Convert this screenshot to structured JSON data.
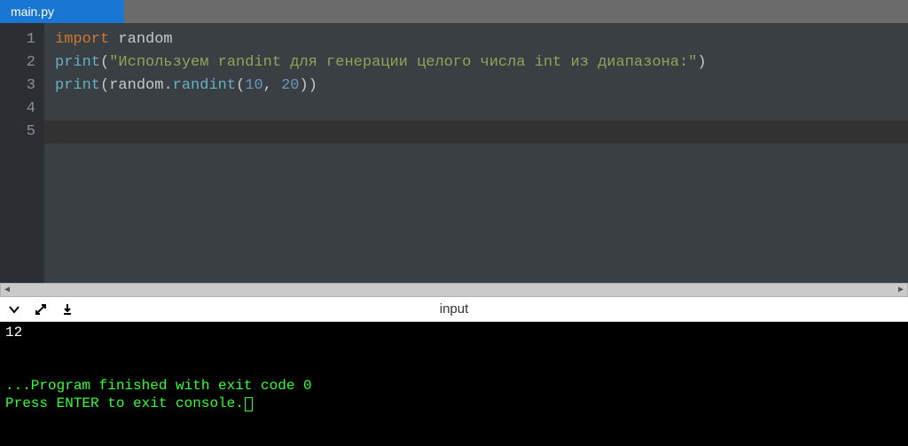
{
  "tab": {
    "filename": "main.py"
  },
  "editor": {
    "line_numbers": [
      "1",
      "2",
      "3",
      "4",
      "5"
    ],
    "code": {
      "l1": {
        "kw": "import",
        "mod": " random"
      },
      "l2": {
        "fn": "print",
        "open": "(",
        "str": "\"Используем randint для генерации целого числа int из диапазона:\"",
        "close": ")"
      },
      "l3": {
        "fn": "print",
        "open": "(",
        "obj": "random",
        "dot": ".",
        "method": "randint",
        "open2": "(",
        "n1": "10",
        "comma": ", ",
        "n2": "20",
        "close2": ")",
        "close": ")"
      }
    }
  },
  "console": {
    "label": "input",
    "output_value": "12",
    "finished": "...Program finished with exit code 0",
    "prompt": "Press ENTER to exit console."
  }
}
